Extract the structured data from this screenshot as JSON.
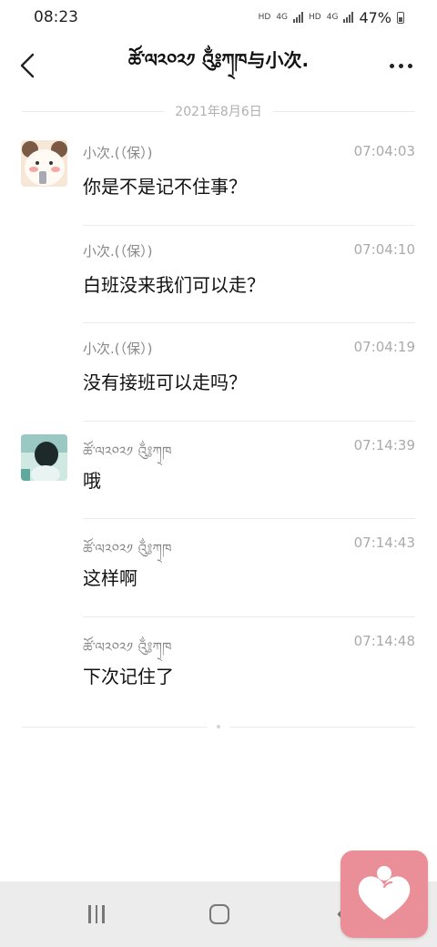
{
  "status_bar": {
    "time": "08:23",
    "hd1": "HD",
    "net1": "4G",
    "hd2": "HD",
    "net2": "4G",
    "battery": "47%"
  },
  "header": {
    "title": "ཚོ་ལ༢༠༢༡ ༃ཀ྄ཁ与小次."
  },
  "date_divider": "2021年8月6日",
  "messages": [
    {
      "sender": "小次.(（保）)",
      "time": "07:04:03",
      "text": "你是不是记不住事？",
      "avatar": "cartoon-bear-avatar",
      "show_avatar": true
    },
    {
      "sender": "小次.(（保）)",
      "time": "07:04:10",
      "text": "白班没来我们可以走？",
      "show_avatar": false
    },
    {
      "sender": "小次.(（保）)",
      "time": "07:04:19",
      "text": "没有接班可以走吗？",
      "show_avatar": false
    },
    {
      "sender": "ཚོ་ལ༢༠༢༡ ༃ཀ྄ཁ",
      "time": "07:14:39",
      "text": "哦",
      "avatar": "photo-avatar",
      "show_avatar": true
    },
    {
      "sender": "ཚོ་ལ༢༠༢༡ ༃ཀ྄ཁ",
      "time": "07:14:43",
      "text": "这样啊",
      "show_avatar": false
    },
    {
      "sender": "ཚོ་ལ༢༠༢༡ ༃ཀ྄ཁ",
      "time": "07:14:48",
      "text": "下次记住了",
      "show_avatar": false
    }
  ],
  "icons": {
    "back": "chevron-left-icon",
    "more": "more-dots-icon",
    "nav_recent": "recent-apps-icon",
    "nav_home": "home-icon",
    "nav_back": "back-icon",
    "widget": "heart-person-icon"
  },
  "colors": {
    "widget_bg": "#ea8f97",
    "nav_bg": "#ececec",
    "muted_text": "#888888"
  }
}
